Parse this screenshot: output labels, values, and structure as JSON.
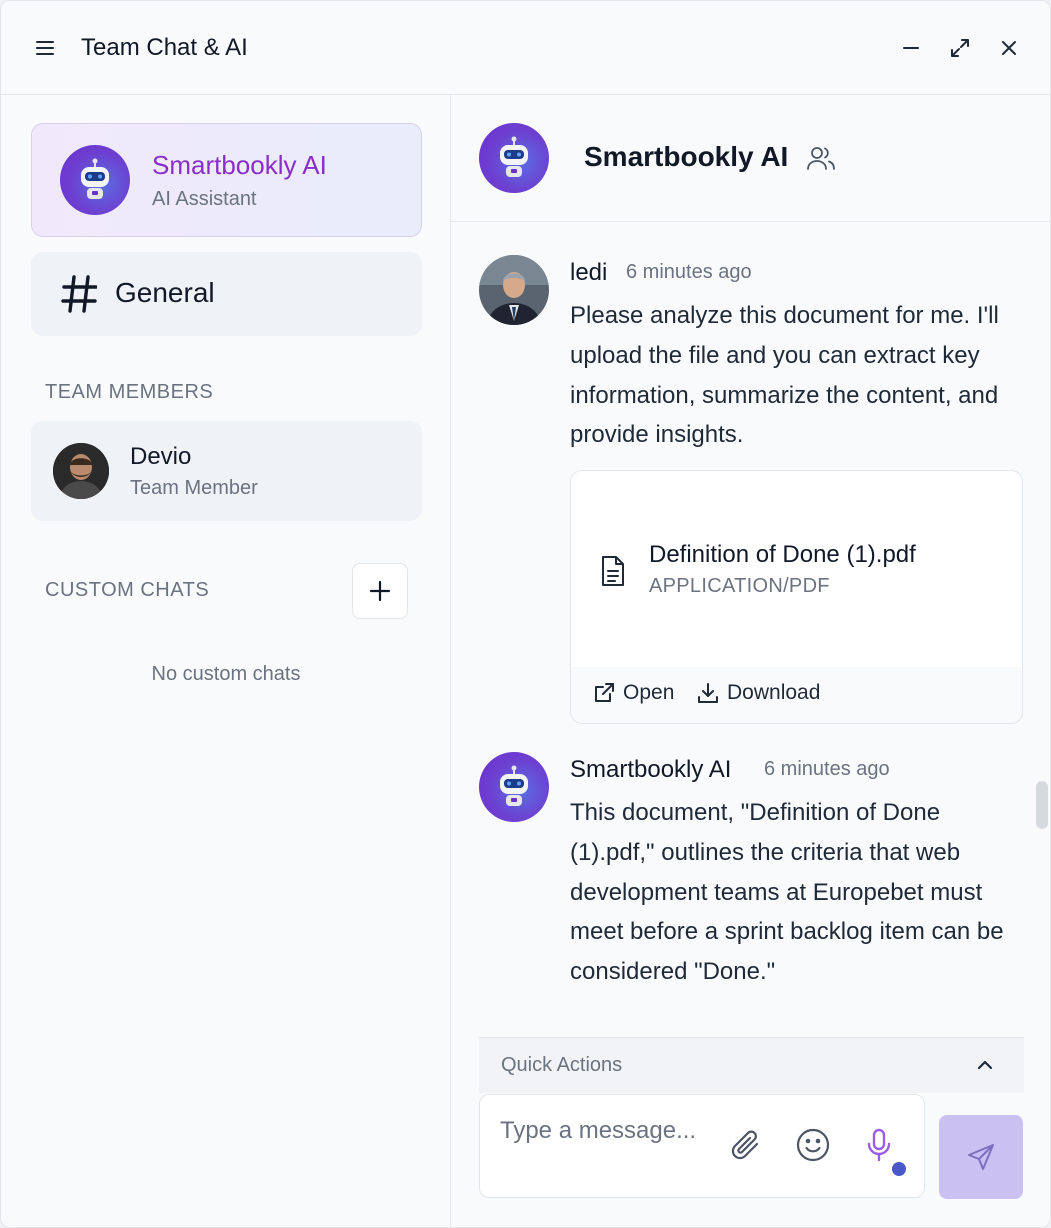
{
  "app": {
    "title": "Team Chat & AI"
  },
  "window_controls": [
    "menu-icon",
    "minimize-icon",
    "expand-icon",
    "close-icon"
  ],
  "sidebar": {
    "ai_assistant": {
      "name": "Smartbookly AI",
      "subtitle": "AI Assistant"
    },
    "general": {
      "label": "General"
    },
    "team_members_label": "TEAM MEMBERS",
    "members": [
      {
        "name": "Devio",
        "role": "Team Member"
      }
    ],
    "custom_chats_label": "CUSTOM CHATS",
    "custom_chats_empty": "No custom chats"
  },
  "chat": {
    "title": "Smartbookly AI",
    "messages": [
      {
        "author": "ledi",
        "time": "6 minutes ago",
        "text": "Please analyze this document for me. I'll upload the file and you can extract key information, summarize the content, and provide insights.",
        "attachment": {
          "name": "Definition of Done (1).pdf",
          "type": "APPLICATION/PDF",
          "open_label": "Open",
          "download_label": "Download"
        }
      },
      {
        "author": "Smartbookly AI",
        "time": "6 minutes ago",
        "text": "This document, \"Definition of Done (1).pdf,\" outlines the criteria that web development teams at Europebet must meet before a sprint backlog item can be considered \"Done.\""
      }
    ],
    "quick_actions_label": "Quick Actions",
    "composer": {
      "placeholder": "Type a message..."
    }
  },
  "colors": {
    "accent_purple": "#8a2ec9",
    "bot_avatar": "#6a2fcf",
    "send_button": "#cbc0f2",
    "mic_icon": "#9b5de5",
    "recording_dot": "#4a58c9"
  }
}
